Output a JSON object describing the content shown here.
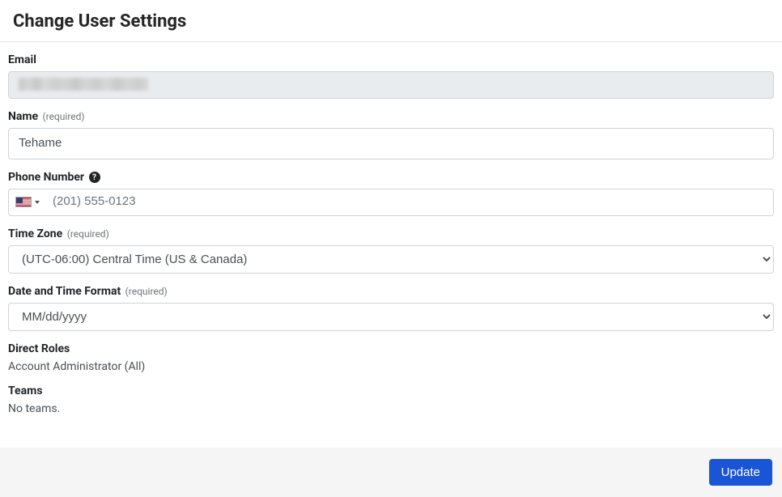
{
  "page_title": "Change User Settings",
  "labels": {
    "email": "Email",
    "name": "Name",
    "phone": "Phone Number",
    "timezone": "Time Zone",
    "dateformat": "Date and Time Format",
    "direct_roles": "Direct Roles",
    "teams": "Teams",
    "required": "(required)"
  },
  "fields": {
    "email_value": "",
    "name_value": "Tehame",
    "phone_value": "",
    "phone_placeholder": "(201) 555-0123",
    "phone_country": "US",
    "timezone_value": "(UTC-06:00) Central Time (US & Canada)",
    "dateformat_value": "MM/dd/yyyy"
  },
  "direct_roles_value": "Account Administrator (All)",
  "teams_value": "No teams.",
  "buttons": {
    "update": "Update"
  }
}
